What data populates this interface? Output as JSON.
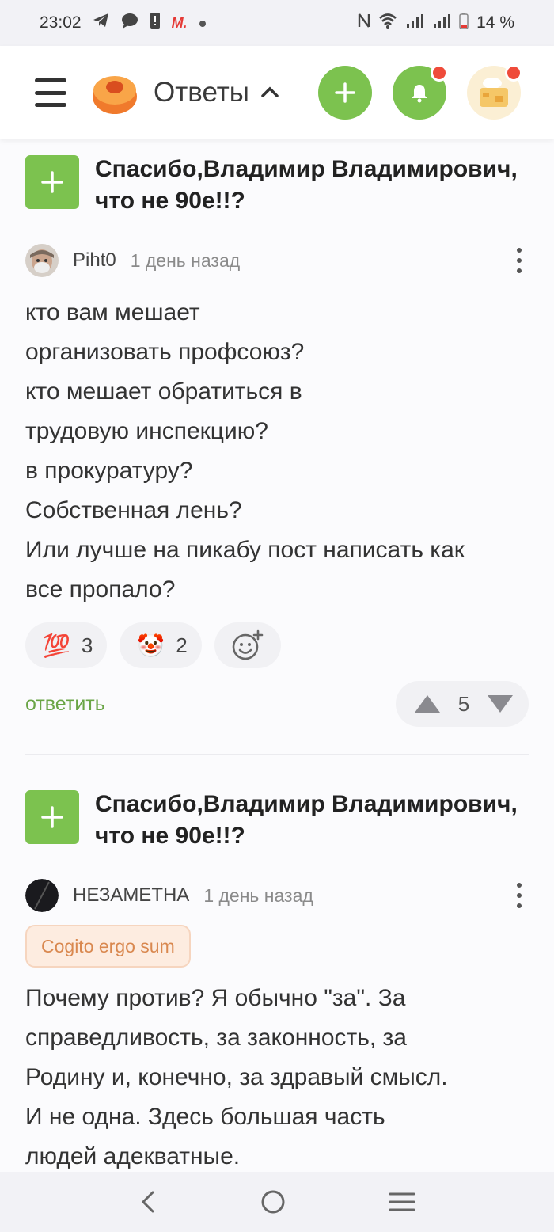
{
  "status": {
    "time": "23:02",
    "battery": "14 %"
  },
  "header": {
    "title": "Ответы"
  },
  "posts": [
    {
      "title": "Спасибо,Владимир Владимирович, что не 90е!!?",
      "user": "Piht0",
      "time": "1 день назад",
      "text": [
        "кто вам мешает",
        "организовать профсоюз?",
        "кто мешает обратиться в",
        "трудовую инспекцию?",
        "в прокуратуру?",
        "Собственная лень?",
        "Или лучше на пикабу пост написать как",
        "все пропало?"
      ],
      "reactions": [
        {
          "emoji": "💯",
          "count": "3",
          "icon": "hundred-points-icon"
        },
        {
          "emoji": "🤡",
          "count": "2",
          "icon": "clown-face-icon"
        }
      ],
      "reply": "ответить",
      "votes": "5"
    },
    {
      "title": "Спасибо,Владимир Владимирович, что не 90е!!?",
      "user": "НЕЗАМЕТНА",
      "time": "1 день назад",
      "badge": "Cogito ergo sum",
      "text": [
        "Почему против? Я обычно \"за\". За",
        "справедливость, за законность, за",
        "Родину и, конечно, за здравый смысл.",
        "И не одна. Здесь большая часть",
        "людей адекватные."
      ]
    }
  ],
  "colors": {
    "accent": "#7cc24f",
    "reply": "#6aa546",
    "notification_dot": "#ef4b3a",
    "badge_text": "#d9884f"
  }
}
